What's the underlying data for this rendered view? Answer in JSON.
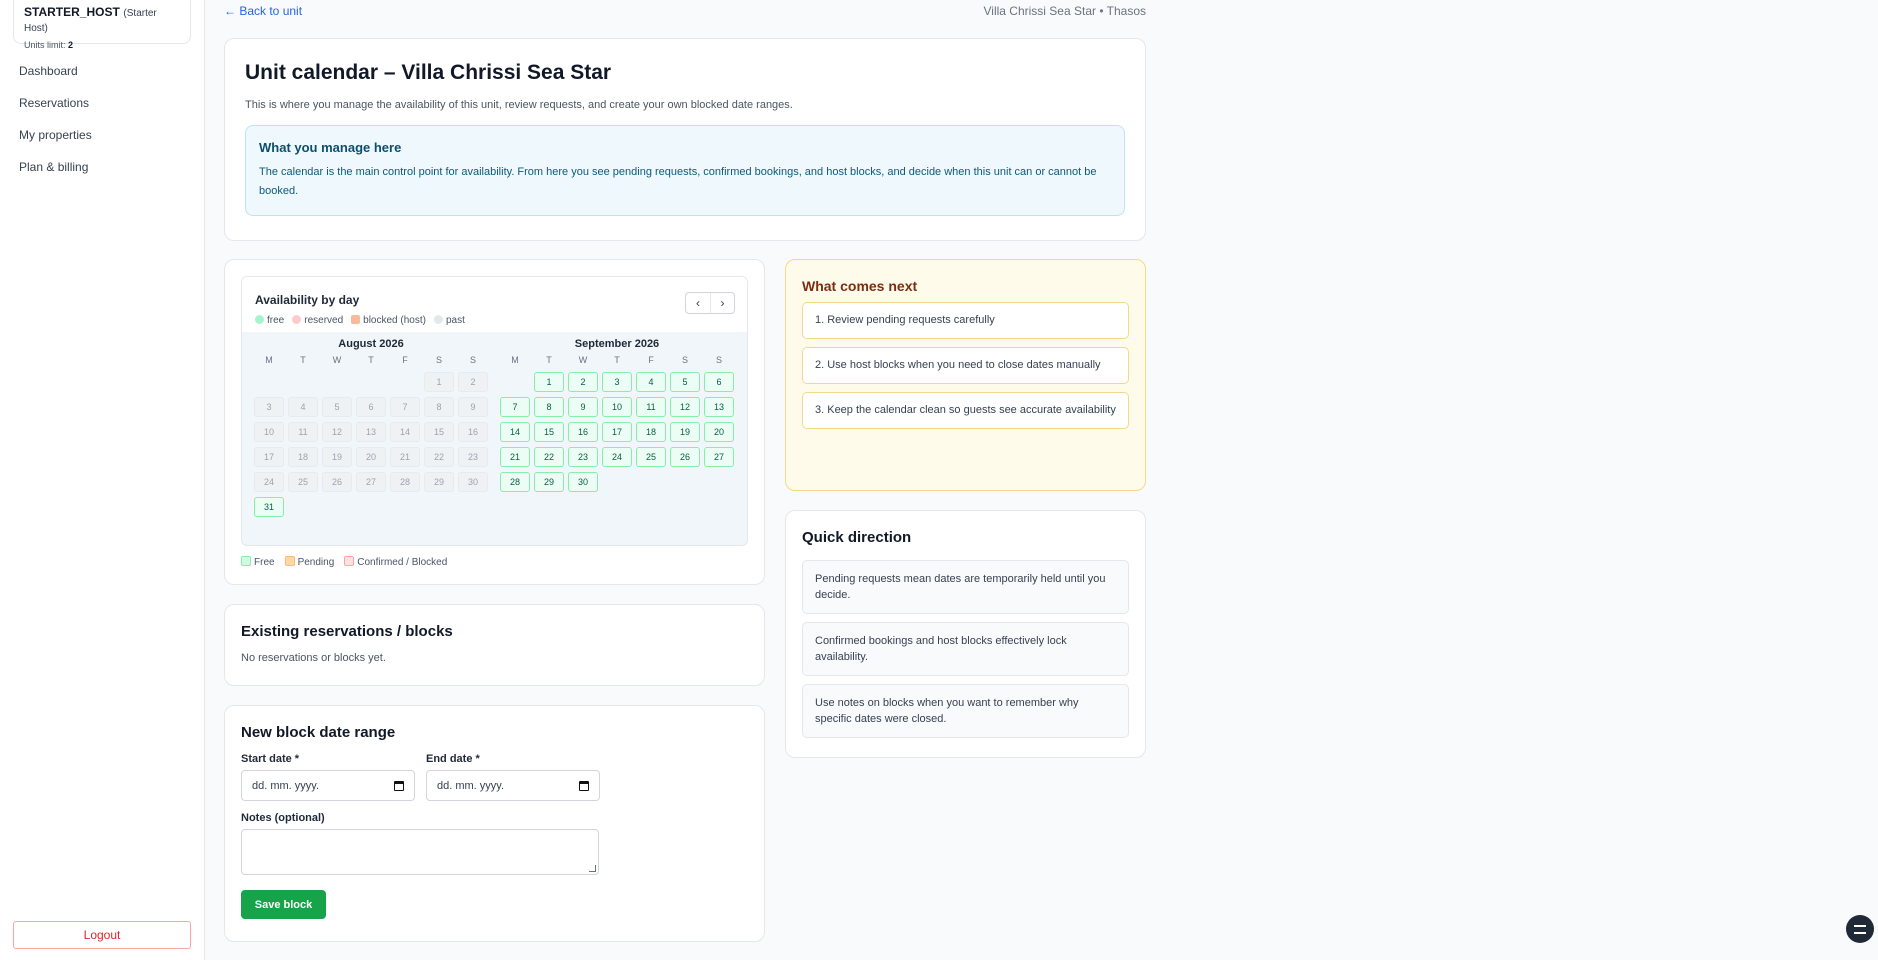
{
  "plan": {
    "name": "STARTER_HOST",
    "type": "(Starter Host)",
    "limit_label": "Units limit:",
    "limit_value": "2"
  },
  "nav": [
    "Dashboard",
    "Reservations",
    "My properties",
    "Plan & billing"
  ],
  "logout": "Logout",
  "topbar": {
    "back": "← Back to unit",
    "location": "Villa Chrissi Sea Star • Thasos"
  },
  "header": {
    "title": "Unit calendar – Villa Chrissi Sea Star",
    "intro": "This is where you manage the availability of this unit, review requests, and create your own blocked date ranges.",
    "info_title": "What you manage here",
    "info_text": "The calendar is the main control point for availability. From here you see pending requests, confirmed bookings, and host blocks, and decide when this unit can or cannot be booked."
  },
  "calendar": {
    "title": "Availability by day",
    "prev": "‹",
    "next": "›",
    "legend": [
      "free",
      "reserved",
      "blocked (host)",
      "past"
    ],
    "weekdays": [
      "M",
      "T",
      "W",
      "T",
      "F",
      "S",
      "S"
    ],
    "months": [
      {
        "title": "August 2026",
        "offset": 5,
        "days": 31,
        "free_from": 31
      },
      {
        "title": "September 2026",
        "offset": 1,
        "days": 30,
        "free_from": 1
      }
    ],
    "bottom_legend": [
      "Free",
      "Pending",
      "Confirmed / Blocked"
    ]
  },
  "reservations": {
    "title": "Existing reservations / blocks",
    "empty": "No reservations or blocks yet."
  },
  "block_form": {
    "title": "New block date range",
    "start_label": "Start date *",
    "end_label": "End date *",
    "date_placeholder": "dd. mm. yyyy.",
    "notes_label": "Notes (optional)",
    "save": "Save block"
  },
  "next": {
    "title": "What comes next",
    "steps": [
      "1. Review pending requests carefully",
      "2. Use host blocks when you need to close dates manually",
      "3. Keep the calendar clean so guests see accurate availability"
    ]
  },
  "direction": {
    "title": "Quick direction",
    "items": [
      "Pending requests mean dates are temporarily held until you decide.",
      "Confirmed bookings and host blocks effectively lock availability.",
      "Use notes on blocks when you want to remember why specific dates were closed."
    ]
  },
  "colors": {
    "free": "#86efac",
    "reserved": "#fca5a5",
    "pending": "#fdba74",
    "past": "#e5e7eb",
    "save": "#16a34a"
  }
}
